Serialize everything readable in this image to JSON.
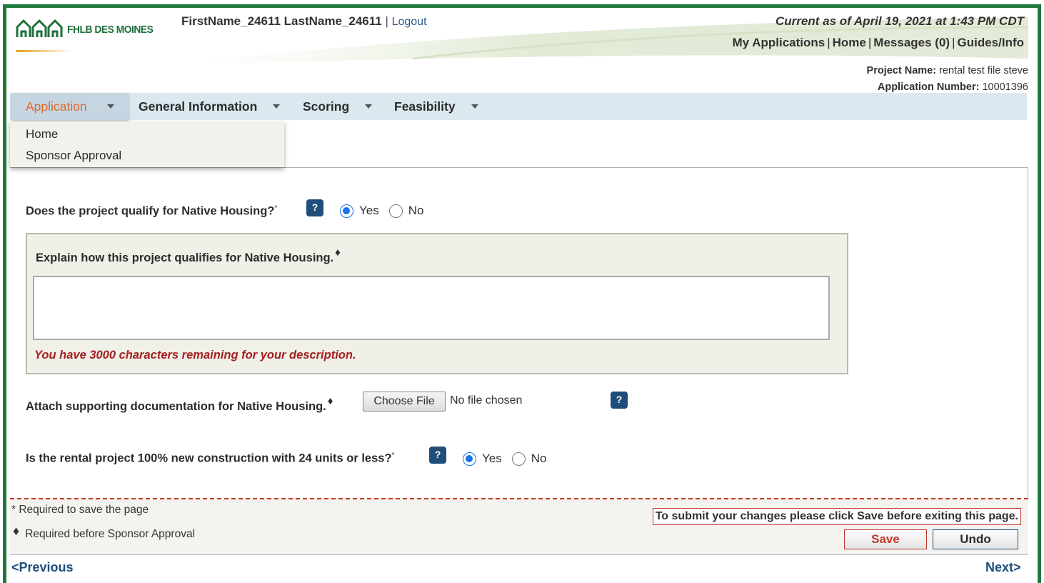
{
  "header": {
    "logo_text": "FHLB DES MOINES",
    "user_name": "FirstName_24611 LastName_24611",
    "logout": "Logout",
    "current_as_of": "Current as of April 19, 2021 at 1:43 PM CDT",
    "top_links": [
      "My Applications",
      "Home",
      "Messages (0)",
      "Guides/Info"
    ],
    "project_name_label": "Project Name:",
    "project_name": "rental test file steve",
    "application_number_label": "Application Number:",
    "application_number": "10001396"
  },
  "nav": {
    "items": [
      "Application",
      "General Information",
      "Scoring",
      "Feasibility"
    ],
    "dropdown": [
      "Home",
      "Sponsor Approval"
    ]
  },
  "form": {
    "q1": "Does the project qualify for Native Housing?",
    "q1_mark": "*",
    "q1_answer": "Yes",
    "explain_label": "Explain how this project qualifies for Native Housing.",
    "diamond": "♦",
    "explain_value": "",
    "remaining": "You have 3000 characters remaining for your description.",
    "attach_label": "Attach supporting documentation for Native Housing.",
    "choose_file": "Choose File",
    "no_file": "No file chosen",
    "q2": "Is the rental project 100% new construction with 24 units or less?",
    "q2_mark": "*",
    "q2_answer": "Yes",
    "yes": "Yes",
    "no": "No",
    "help": "?"
  },
  "footer": {
    "required_save": "* Required to save the page",
    "required_sponsor": "Required before Sponsor Approval",
    "submit_msg": "To submit your changes please click Save before exiting this page.",
    "save": "Save",
    "undo": "Undo",
    "previous": "<Previous",
    "next": "Next>"
  },
  "colors": {
    "frame_green": "#1d7a3a",
    "nav_bg": "#dce8ef",
    "active_tab_text": "#e06a2c",
    "help_bg": "#1f4e7a",
    "alert_red": "#c0392b"
  }
}
